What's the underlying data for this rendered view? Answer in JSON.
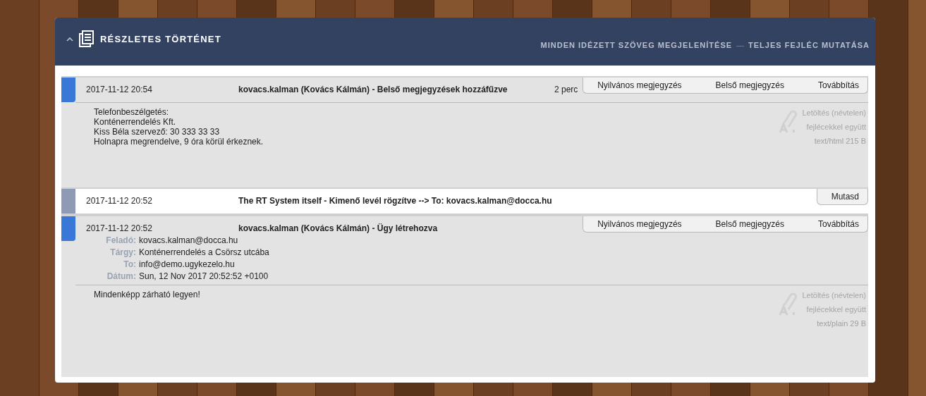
{
  "header": {
    "title": "RÉSZLETES TÖRTÉNET",
    "links": [
      "MINDEN IDÉZETT SZÖVEG MEGJELENÍTÉSE",
      "TELJES FEJLÉC MUTATÁSA"
    ],
    "separator": "—"
  },
  "transactions": [
    {
      "kind": "note",
      "color": "#3a78d8",
      "date": "2017-11-12 20:54",
      "description": "kovacs.kalman (Kovács Kálmán) - Belső megjegyzések hozzáfűzve",
      "time_taken": "2 perc",
      "actions": [
        "Nyilvános megjegyzés",
        "Belső megjegyzés",
        "Továbbítás"
      ],
      "body": [
        "Telefonbeszélgetés:",
        "Konténerrendelés Kft.",
        "Kiss Béla szervező: 30 333 33 33",
        "Holnapra megrendelve, 9 óra körül érkeznek."
      ],
      "attachment": {
        "download": "Letöltés (névtelen)",
        "with_headers": "fejlécekkel együtt",
        "type": "text/html 215 B"
      }
    },
    {
      "kind": "outgoing",
      "color": "#8f9ab5",
      "date": "2017-11-12 20:52",
      "description": "The RT System itself - Kimenő levél rögzítve --> To: kovacs.kalman@docca.hu",
      "actions": [
        "Mutasd"
      ]
    },
    {
      "kind": "note",
      "color": "#3a78d8",
      "date": "2017-11-12 20:52",
      "description": "kovacs.kalman (Kovács Kálmán) - Ügy létrehozva",
      "actions": [
        "Nyilvános megjegyzés",
        "Belső megjegyzés",
        "Továbbítás"
      ],
      "headers": [
        {
          "label": "Feladó:",
          "value": "kovacs.kalman@docca.hu"
        },
        {
          "label": "Tárgy:",
          "value": "Konténerrendelés a Csörsz utcába"
        },
        {
          "label": "To:",
          "value": "info@demo.ugykezelo.hu"
        },
        {
          "label": "Dátum:",
          "value": "Sun, 12 Nov 2017 20:52:52 +0100"
        }
      ],
      "body": [
        "Mindenképp zárható legyen!"
      ],
      "attachment": {
        "download": "Letöltés (névtelen)",
        "with_headers": "fejlécekkel együtt",
        "type": "text/plain 29 B"
      }
    }
  ]
}
